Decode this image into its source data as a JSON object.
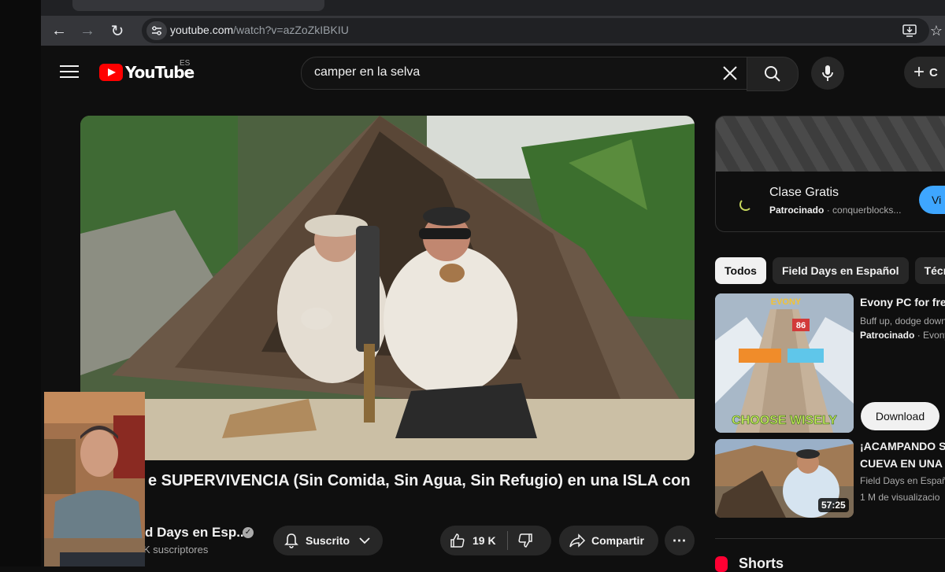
{
  "browser": {
    "url_host": "youtube.com",
    "url_path": "/watch?v=azZoZkIBKIU"
  },
  "masthead": {
    "logo_text": "YouTube",
    "country_code": "ES",
    "search_value": "camper en la selva",
    "create_label": "C"
  },
  "video": {
    "title": "e SUPERVIVENCIA (Sin Comida, Sin Agua, Sin Refugio) en una ISLA con",
    "channel_name": "d Days en Esp...",
    "subscribers": "K suscriptores",
    "subscribe_label": "Suscrito",
    "likes": "19 K",
    "share_label": "Compartir"
  },
  "sidebar": {
    "ad": {
      "title": "Clase Gratis",
      "sponsored": "Patrocinado",
      "advertiser": "· conquerblocks...",
      "button_label": "Vi"
    },
    "chips": [
      "Todos",
      "Field Days en Español",
      "Técn"
    ],
    "recommendations": [
      {
        "title": "Evony PC for free",
        "meta1": "Buff up, dodge down",
        "sponsored": "Patrocinado",
        "meta2": "· Evony",
        "thumb_text": "CHOOSE WISELY",
        "thumb_brand": "EVONY",
        "thumb_badge": "86",
        "button_label": "Download"
      },
      {
        "title_line1": "¡ACAMPANDO S",
        "title_line2": "CUEVA EN UNA I",
        "channel": "Field Days en Español",
        "views": "1 M de visualizacio",
        "duration": "57:25"
      }
    ],
    "shorts_label": "Shorts"
  }
}
